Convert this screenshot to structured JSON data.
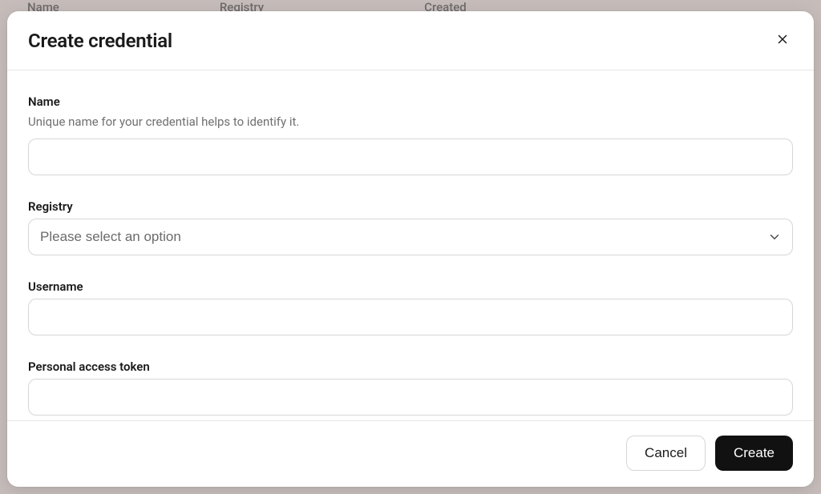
{
  "background": {
    "columns": [
      "Name",
      "Registry",
      "Created"
    ]
  },
  "modal": {
    "title": "Create credential",
    "close_label": "Close",
    "fields": {
      "name": {
        "label": "Name",
        "hint": "Unique name for your credential helps to identify it.",
        "value": ""
      },
      "registry": {
        "label": "Registry",
        "placeholder": "Please select an option",
        "value": ""
      },
      "username": {
        "label": "Username",
        "value": ""
      },
      "pat": {
        "label": "Personal access token",
        "value": ""
      }
    },
    "actions": {
      "cancel": "Cancel",
      "create": "Create"
    }
  }
}
